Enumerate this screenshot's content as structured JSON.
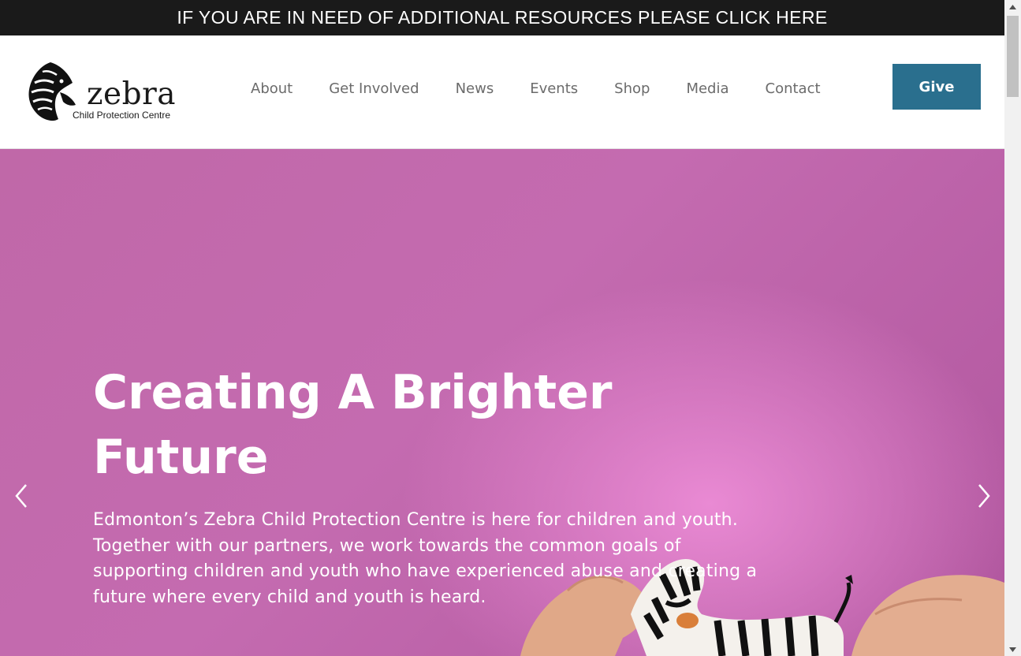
{
  "topbar": {
    "text": "IF YOU ARE IN NEED OF ADDITIONAL RESOURCES PLEASE CLICK HERE"
  },
  "logo": {
    "name": "zebra",
    "subtitle": "Child Protection Centre"
  },
  "nav": {
    "items": [
      "About",
      "Get Involved",
      "News",
      "Events",
      "Shop",
      "Media",
      "Contact"
    ],
    "give_label": "Give"
  },
  "hero": {
    "title": "Creating A Brighter Future",
    "text": "Edmonton’s Zebra Child Protection Centre is here for children and youth. Together with our partners, we work towards the common goals of supporting children and youth who have experienced abuse and creating a future where every child and youth is heard.",
    "prev_icon": "chevron-left-icon",
    "next_icon": "chevron-right-icon"
  },
  "colors": {
    "topbar_bg": "#1a1a1a",
    "nav_text": "#6b6b6b",
    "give_bg": "#2a6f8e",
    "hero_bg": "#c46bb0"
  }
}
